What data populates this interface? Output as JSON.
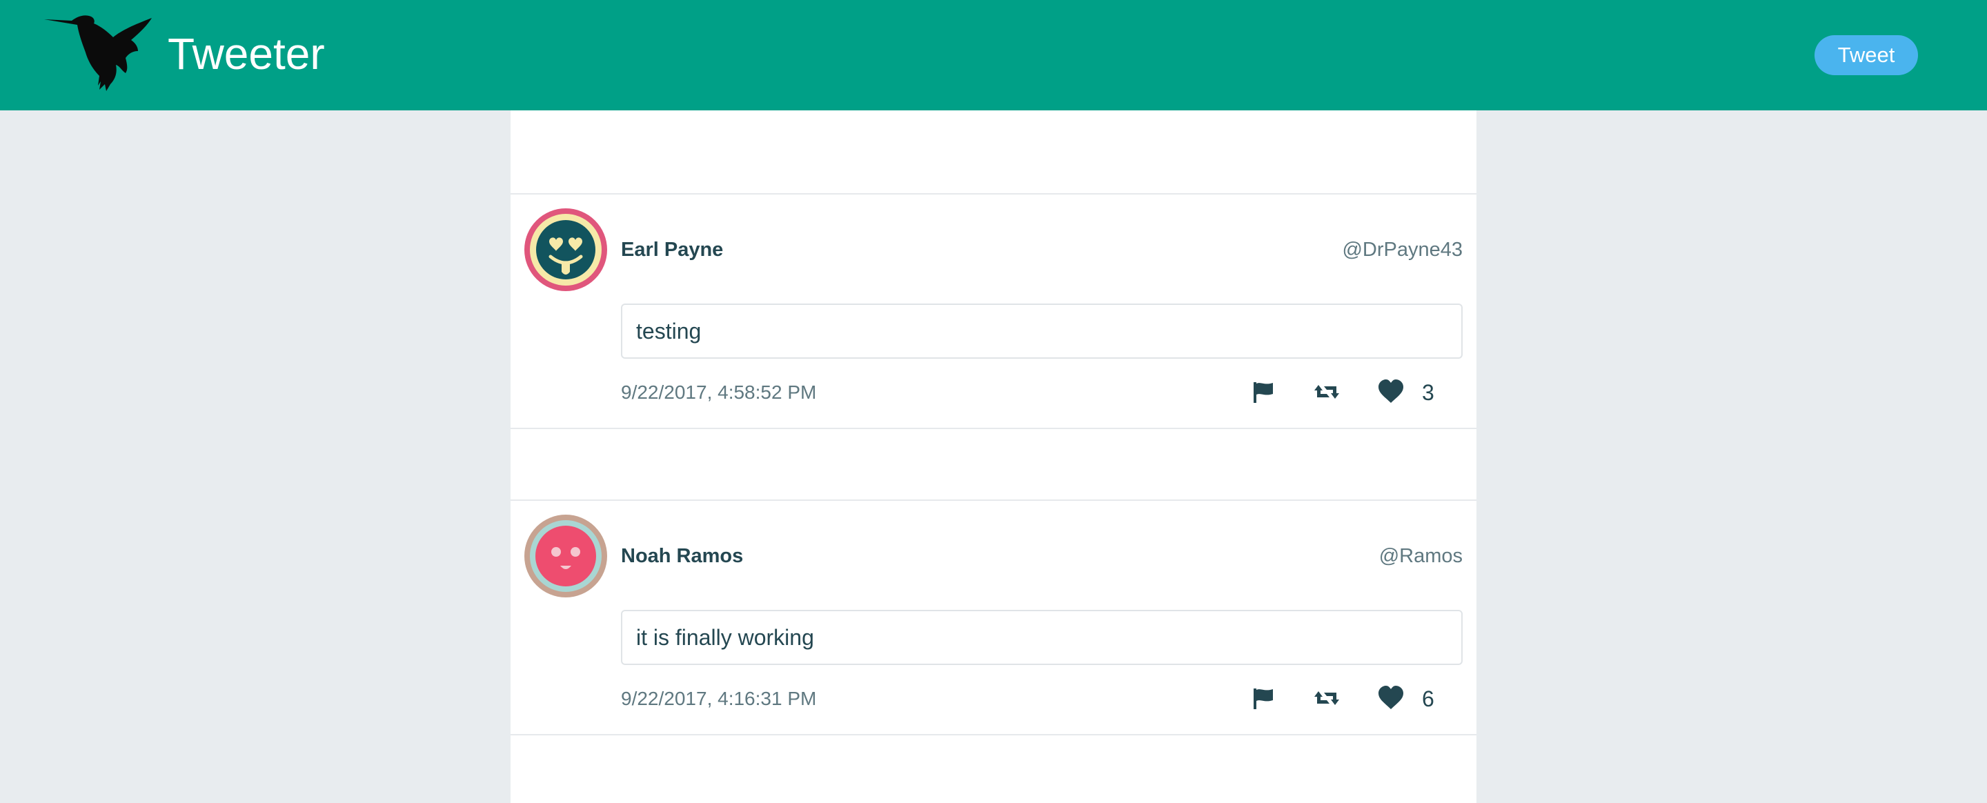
{
  "navbar": {
    "brand": "Tweeter",
    "compose_label": "Tweet",
    "background": "#00a087",
    "logo_icon": "hummingbird-icon"
  },
  "tweets": [
    {
      "name": "Earl Payne",
      "handle": "@DrPayne43",
      "text": "testing",
      "timestamp": "9/22/2017, 4:58:52 PM",
      "likes": "3",
      "avatar_icon": "heart-eyes-face-icon",
      "avatar_colors": {
        "ring": "#e0567c",
        "inner": "#f6e9a8",
        "face": "#12545e"
      }
    },
    {
      "name": "Noah Ramos",
      "handle": "@Ramos",
      "text": "it is finally working",
      "timestamp": "9/22/2017, 4:16:31 PM",
      "likes": "6",
      "avatar_icon": "smiling-face-icon",
      "avatar_colors": {
        "ring": "#c7a391",
        "inner": "#a9d6d3",
        "face": "#ee4d6f"
      }
    }
  ],
  "actions": {
    "flag_icon": "flag-icon",
    "retweet_icon": "retweet-icon",
    "like_icon": "heart-icon"
  }
}
